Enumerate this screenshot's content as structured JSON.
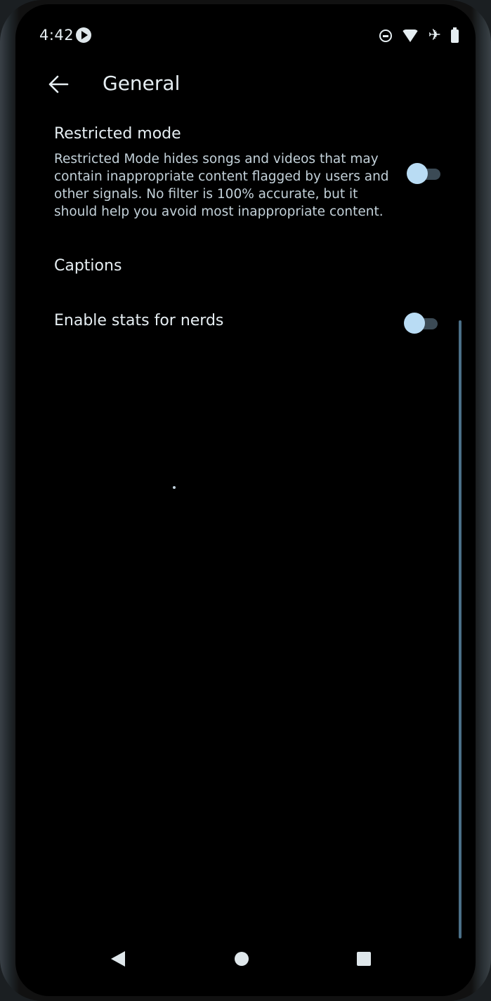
{
  "status_bar": {
    "time": "4:42",
    "icons": [
      "media-play-icon",
      "do-not-disturb-icon",
      "wifi-icon",
      "airplane-mode-icon",
      "battery-icon"
    ]
  },
  "app_bar": {
    "title": "General",
    "back_icon": "arrow-back-icon"
  },
  "settings": {
    "restricted_mode": {
      "title": "Restricted mode",
      "description": "Restricted Mode hides songs and videos that may contain inappropriate content flagged by users and other signals. No filter is 100% accurate, but it should help you avoid most inappropriate content.",
      "enabled": false
    },
    "captions": {
      "title": "Captions"
    },
    "stats_for_nerds": {
      "title": "Enable stats for nerds",
      "enabled": false
    }
  },
  "nav_bar": {
    "icons": [
      "nav-back-icon",
      "nav-home-icon",
      "nav-recents-icon"
    ]
  },
  "colors": {
    "background": "#000000",
    "text_primary": "#e6eef2",
    "text_secondary": "#c3d1d9",
    "toggle_thumb": "#b9dcf4",
    "toggle_track": "#3b4a55"
  }
}
